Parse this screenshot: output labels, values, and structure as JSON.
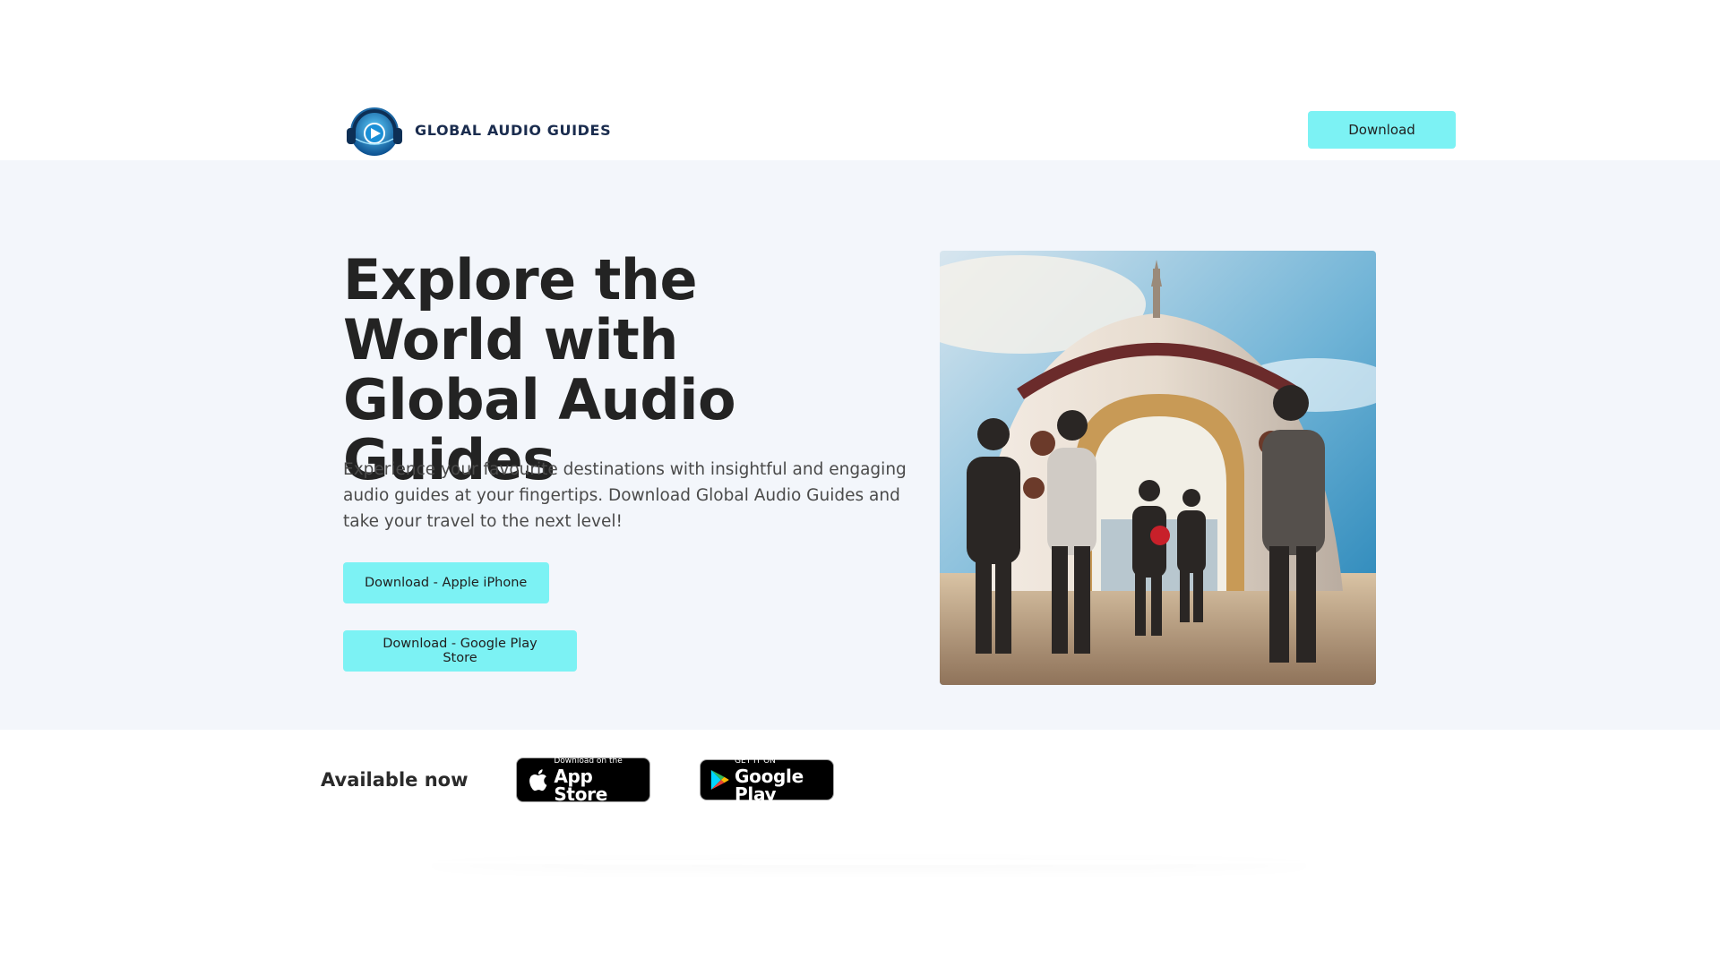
{
  "header": {
    "brand": "GLOBAL AUDIO GUIDES",
    "logo_icon": "headphones-play-globe-icon",
    "download_label": "Download"
  },
  "hero": {
    "title": "Explore the World with Global Audio Guides",
    "description": "Experience your favourite destinations with insightful and engaging audio guides at your fingertips. Download Global Audio Guides and take your travel to the next level!",
    "buttons": [
      {
        "label": "Download - Apple iPhone"
      },
      {
        "label": "Download - Google Play Store"
      }
    ],
    "image_icon": "travelers-landmark-photo"
  },
  "available": {
    "label": "Available now",
    "app_store": {
      "small": "Download on the",
      "big": "App Store",
      "icon": "apple-icon"
    },
    "google_play": {
      "small": "GET IT ON",
      "big": "Google Play",
      "icon": "google-play-icon"
    }
  },
  "colors": {
    "accent": "#7cf2f4",
    "hero_bg": "#f3f6fb",
    "brand_text": "#1a2c4e"
  }
}
